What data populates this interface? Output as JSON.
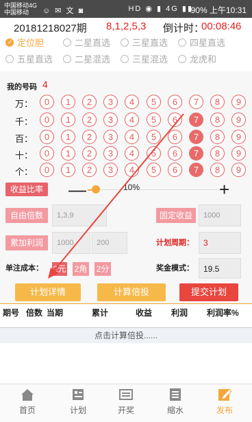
{
  "status_bar": {
    "carrier1": "中国移动4G",
    "carrier2": "中国移动",
    "icons": "☺ ✉ 文 ◙",
    "right_icons": "HD ◉ ▮ 4G ▮▮",
    "battery": "90%",
    "time": "上午10:31"
  },
  "header": {
    "period": "20181218027期",
    "numbers": "8,1,2,5,3",
    "countdown_label": "倒计时：",
    "countdown": "00:08:46"
  },
  "modes": [
    {
      "label": "定位胆",
      "selected": true
    },
    {
      "label": "二星直选",
      "selected": false
    },
    {
      "label": "三星直选",
      "selected": false
    },
    {
      "label": "四星直选",
      "selected": false
    },
    {
      "label": "五星直选",
      "selected": false
    },
    {
      "label": "二星混选",
      "selected": false
    },
    {
      "label": "三星混选",
      "selected": false
    },
    {
      "label": "龙虎和",
      "selected": false
    }
  ],
  "my_numbers": {
    "label": "我的号码",
    "count": "4"
  },
  "digit_rows": [
    {
      "label": "万：",
      "selected": []
    },
    {
      "label": "千：",
      "selected": [
        7
      ]
    },
    {
      "label": "百：",
      "selected": [
        7
      ]
    },
    {
      "label": "十：",
      "selected": [
        7
      ]
    },
    {
      "label": "个：",
      "selected": [
        7
      ]
    }
  ],
  "balls": [
    "0",
    "1",
    "2",
    "3",
    "4",
    "5",
    "6",
    "7",
    "8",
    "9"
  ],
  "profit_ratio": {
    "label": "收益比率",
    "value": "10%",
    "level": 0.03
  },
  "self_multiplier": {
    "label": "自由倍数",
    "placeholder": "1,3,9"
  },
  "fixed_profit": {
    "label": "固定收益",
    "placeholder": "1000"
  },
  "accumulate": {
    "label": "累加利润",
    "placeholder1": "1000",
    "placeholder2": "200"
  },
  "plan_period": {
    "label": "计划周期：",
    "value": "3"
  },
  "unit_cost": {
    "label": "单注成本：",
    "options": [
      "2元",
      "2角",
      "2分"
    ],
    "selected": 0
  },
  "prize_mode": {
    "label": "奖金模式：",
    "value": "19.5"
  },
  "buttons": {
    "plan_detail": "计划详情",
    "calc": "计算倍投",
    "submit": "提交计划"
  },
  "table": {
    "headers": [
      "期号",
      "倍数",
      "当期",
      "累计",
      "收益",
      "利润",
      "利润率%"
    ],
    "hint": "点击计算倍投......"
  },
  "nav": [
    {
      "label": "首页",
      "icon": "home-icon",
      "active": false
    },
    {
      "label": "计划",
      "icon": "plan-icon",
      "active": false
    },
    {
      "label": "开奖",
      "icon": "lottery-icon",
      "active": false
    },
    {
      "label": "缩水",
      "icon": "shrink-icon",
      "active": false
    },
    {
      "label": "发布",
      "icon": "publish-icon",
      "active": true
    }
  ],
  "colors": {
    "accent": "#f4a73c",
    "red": "#e02020",
    "ball": "#e65c5c",
    "ball_selected": "#e86b6b"
  }
}
